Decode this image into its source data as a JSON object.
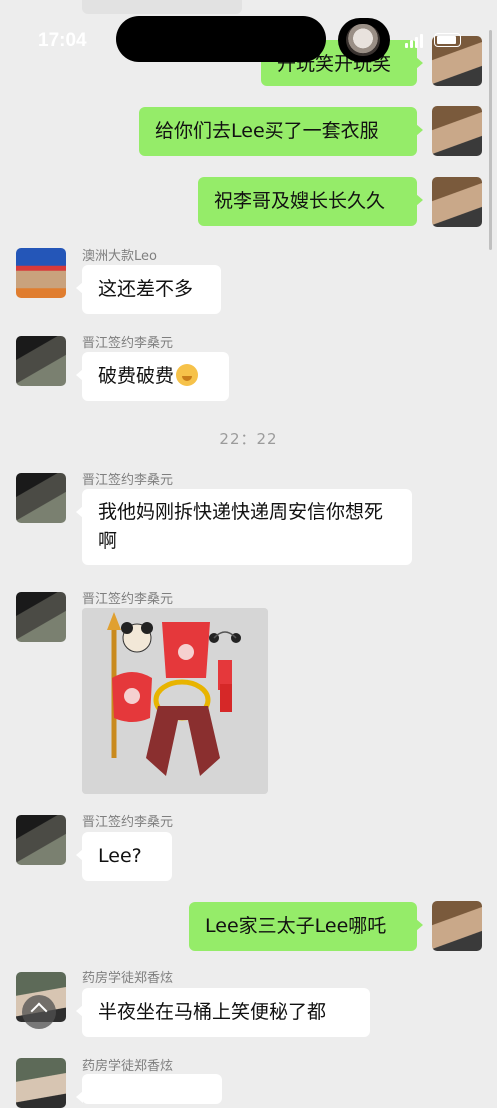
{
  "status": {
    "time": "17:04"
  },
  "messages": {
    "m1": {
      "text": "开玩笑开玩笑"
    },
    "m2": {
      "text": "给你们去Lee买了一套衣服"
    },
    "m3": {
      "text": "祝李哥及嫂长长久久"
    },
    "m4": {
      "sender": "澳洲大款Leo",
      "text": "这还差不多"
    },
    "m5": {
      "sender": "晋江签约李桑元",
      "text": "破费破费"
    },
    "time_separator": "22：22",
    "m6": {
      "sender": "晋江签约李桑元",
      "text": "我他妈刚拆快递快递周安信你想死啊"
    },
    "m7": {
      "sender": "晋江签约李桑元"
    },
    "m8": {
      "sender": "晋江签约李桑元",
      "text": "Lee?"
    },
    "m9": {
      "text": "Lee家三太子Lee哪吒"
    },
    "m10": {
      "sender": "药房学徒郑香炫",
      "text": "半夜坐在马桶上笑便秘了都"
    },
    "m11": {
      "sender": "药房学徒郑香炫"
    }
  },
  "icons": [
    "signal-icon",
    "battery-icon",
    "chevron-up-icon",
    "smiling-emoji-icon"
  ],
  "colors": {
    "background": "#ededed",
    "self_bubble": "#95ec69",
    "other_bubble": "#ffffff"
  }
}
